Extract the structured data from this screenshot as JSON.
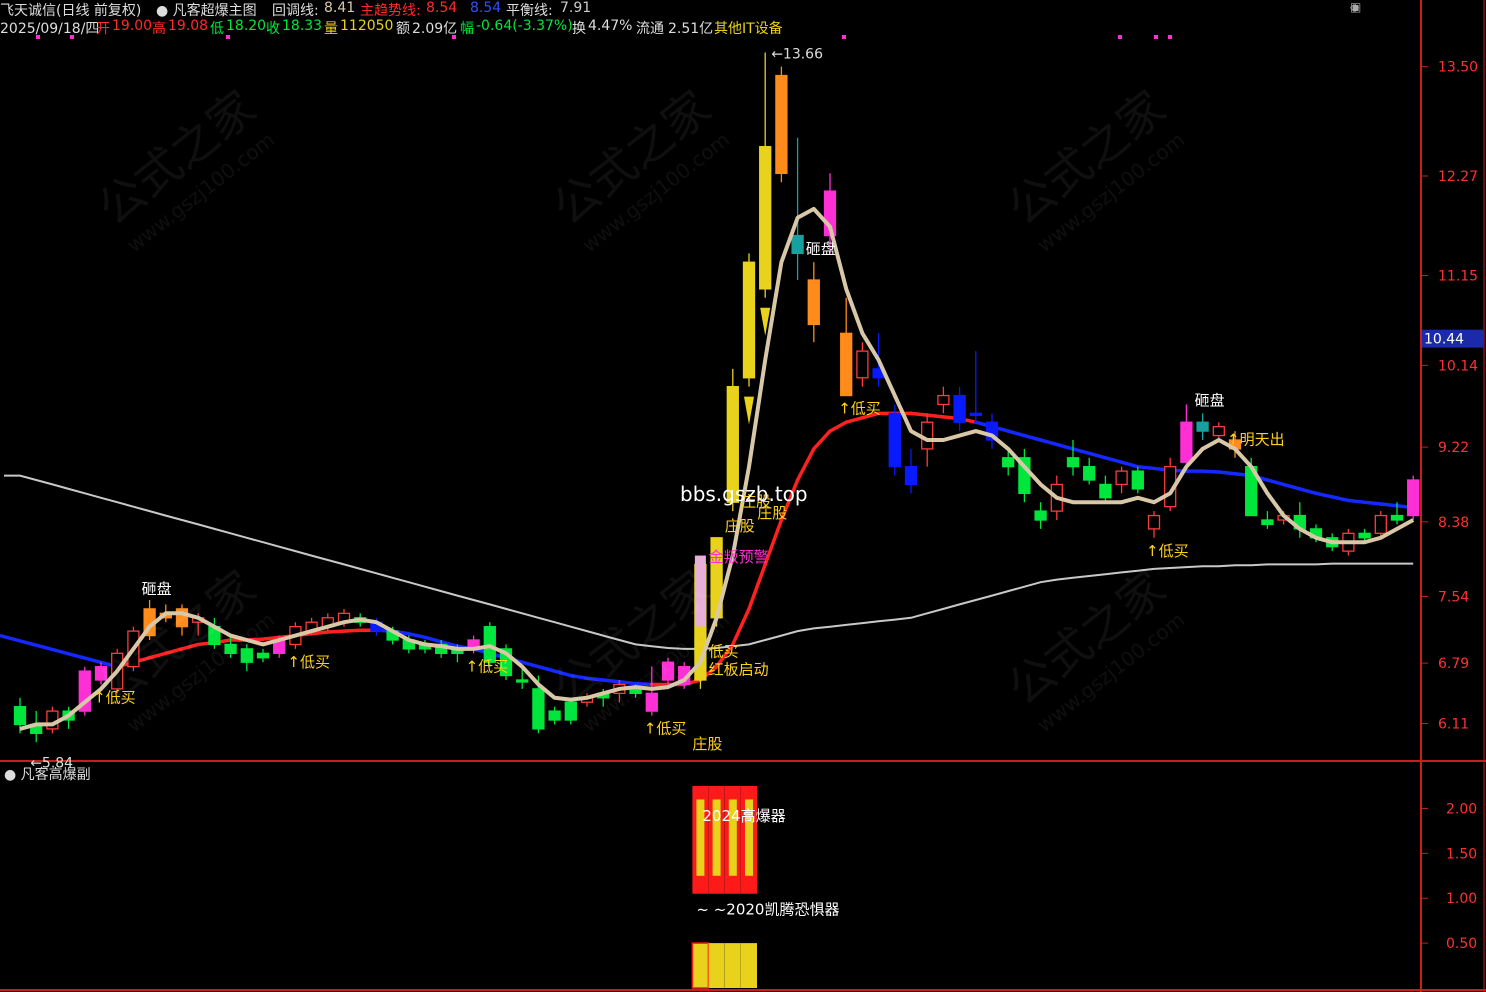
{
  "header": {
    "stock": "飞天诚信(日线 前复权)",
    "indicator": "凡客超爆主图",
    "callback_label": "回调线:",
    "callback_value": "8.41",
    "trend_label": "主趋势线:",
    "trend_value": "8.54",
    "trend_value2": "8.54",
    "balance_label": "平衡线:",
    "balance_value": "7.91",
    "date": "2025/09/18/四",
    "open_label": "开",
    "open": "19.00",
    "high_label": "高",
    "high": "19.08",
    "low_label": "低",
    "low": "18.20",
    "close_label": "收",
    "close": "18.33",
    "vol_label": "量",
    "vol": "112050",
    "amt_label": "额",
    "amt": "2.09亿",
    "chg_label": "幅",
    "chg": "-0.64(-3.37%)",
    "turn_label": "换",
    "turn": "4.47%",
    "float_label": "流通",
    "float": "2.51亿",
    "sector": "其他IT设备"
  },
  "colors": {
    "up": "#ff3b3b",
    "down": "#00e63d",
    "yellow": "#e8d21c",
    "orange": "#ff8c1a",
    "magenta": "#ff2fd6",
    "blue": "#0a1aff",
    "teal": "#18a0a0",
    "callback": "#d8c8a8",
    "trend_up": "#ff2020",
    "trend_down": "#1428ff",
    "balance": "#c8c8c8",
    "axis": "#c81e1e"
  },
  "subchart": {
    "title": "凡客高爆副",
    "label_top": "2024高爆器",
    "label_mid": "~ ~2020凯腾恐惧器"
  },
  "watermark": {
    "cn": "公式之家",
    "url": "www.gszj100.com",
    "site": "bbs.gszb.top"
  },
  "chart_data": {
    "type": "candlestick",
    "ylim": [
      5.7,
      13.8
    ],
    "yticks": [
      "13.50",
      "12.27",
      "11.15",
      "10.14",
      "9.22",
      "8.38",
      "7.54",
      "6.79",
      "6.11"
    ],
    "current_price_tag": "10.44",
    "max_label": "13.66",
    "min_label": "5.84",
    "sub_ylim": [
      0,
      2.25
    ],
    "sub_yticks": [
      "2.00",
      "1.50",
      "1.00",
      "0.50"
    ],
    "candles": [
      [
        6.3,
        6.4,
        6.0,
        6.1,
        "g"
      ],
      [
        6.1,
        6.25,
        5.9,
        6.0,
        "g"
      ],
      [
        6.05,
        6.3,
        6.0,
        6.25,
        "u"
      ],
      [
        6.25,
        6.3,
        6.05,
        6.15,
        "g"
      ],
      [
        6.25,
        6.75,
        6.2,
        6.7,
        "m"
      ],
      [
        6.6,
        6.8,
        6.55,
        6.75,
        "m"
      ],
      [
        6.5,
        6.95,
        6.45,
        6.9,
        "u"
      ],
      [
        6.75,
        7.2,
        6.7,
        7.15,
        "u"
      ],
      [
        7.1,
        7.5,
        7.05,
        7.4,
        "o"
      ],
      [
        7.3,
        7.45,
        7.25,
        7.35,
        "o"
      ],
      [
        7.4,
        7.45,
        7.1,
        7.2,
        "o"
      ],
      [
        7.25,
        7.35,
        7.1,
        7.3,
        "u"
      ],
      [
        7.2,
        7.3,
        6.95,
        7.0,
        "g"
      ],
      [
        7.0,
        7.1,
        6.85,
        6.9,
        "g"
      ],
      [
        6.8,
        7.0,
        6.7,
        6.95,
        "g"
      ],
      [
        6.85,
        6.95,
        6.8,
        6.9,
        "g"
      ],
      [
        6.9,
        7.1,
        6.85,
        7.05,
        "m"
      ],
      [
        7.0,
        7.25,
        6.95,
        7.2,
        "u"
      ],
      [
        7.15,
        7.3,
        7.1,
        7.25,
        "u"
      ],
      [
        7.2,
        7.35,
        7.15,
        7.3,
        "u"
      ],
      [
        7.25,
        7.4,
        7.2,
        7.35,
        "u"
      ],
      [
        7.3,
        7.35,
        7.2,
        7.25,
        "g"
      ],
      [
        7.25,
        7.3,
        7.1,
        7.15,
        "b"
      ],
      [
        7.15,
        7.2,
        7.0,
        7.05,
        "g"
      ],
      [
        7.05,
        7.1,
        6.9,
        6.95,
        "g"
      ],
      [
        6.95,
        7.05,
        6.9,
        7.0,
        "g"
      ],
      [
        7.0,
        7.05,
        6.85,
        6.9,
        "g"
      ],
      [
        6.9,
        7.0,
        6.8,
        6.95,
        "g"
      ],
      [
        6.95,
        7.1,
        6.9,
        7.05,
        "m"
      ],
      [
        6.8,
        7.25,
        6.75,
        7.2,
        "g"
      ],
      [
        6.95,
        7.0,
        6.6,
        6.65,
        "g"
      ],
      [
        6.6,
        6.75,
        6.5,
        6.6,
        "g"
      ],
      [
        6.5,
        6.65,
        6.0,
        6.05,
        "g"
      ],
      [
        6.15,
        6.3,
        6.1,
        6.25,
        "g"
      ],
      [
        6.15,
        6.4,
        6.1,
        6.35,
        "g"
      ],
      [
        6.35,
        6.45,
        6.3,
        6.4,
        "u"
      ],
      [
        6.4,
        6.5,
        6.3,
        6.45,
        "g"
      ],
      [
        6.45,
        6.6,
        6.35,
        6.55,
        "u"
      ],
      [
        6.5,
        6.55,
        6.4,
        6.45,
        "g"
      ],
      [
        6.45,
        6.75,
        6.2,
        6.25,
        "m"
      ],
      [
        6.6,
        6.85,
        6.55,
        6.8,
        "m"
      ],
      [
        6.55,
        6.8,
        6.5,
        6.75,
        "m"
      ],
      [
        6.6,
        7.9,
        6.5,
        7.9,
        "y"
      ],
      [
        7.3,
        8.2,
        7.2,
        8.2,
        "y"
      ],
      [
        8.6,
        10.1,
        8.5,
        9.9,
        "y"
      ],
      [
        10.0,
        11.4,
        9.9,
        11.3,
        "y"
      ],
      [
        11.0,
        13.66,
        10.9,
        12.6,
        "y"
      ],
      [
        12.3,
        13.5,
        12.2,
        13.4,
        "o"
      ],
      [
        11.4,
        12.7,
        11.1,
        11.6,
        "t"
      ],
      [
        10.6,
        11.3,
        10.4,
        11.1,
        "o"
      ],
      [
        12.1,
        12.3,
        11.4,
        11.6,
        "m"
      ],
      [
        10.5,
        10.9,
        9.8,
        9.8,
        "o"
      ],
      [
        10.0,
        10.4,
        9.9,
        10.3,
        "u"
      ],
      [
        10.1,
        10.5,
        9.9,
        10.0,
        "b"
      ],
      [
        9.6,
        9.7,
        8.9,
        9.0,
        "b"
      ],
      [
        9.0,
        9.2,
        8.7,
        8.8,
        "b"
      ],
      [
        9.5,
        9.6,
        9.0,
        9.2,
        "u"
      ],
      [
        9.7,
        9.9,
        9.6,
        9.8,
        "u"
      ],
      [
        9.8,
        9.9,
        9.4,
        9.5,
        "b"
      ],
      [
        9.6,
        10.3,
        9.5,
        9.6,
        "b"
      ],
      [
        9.5,
        9.6,
        9.2,
        9.3,
        "b"
      ],
      [
        9.1,
        9.2,
        8.9,
        9.0,
        "g"
      ],
      [
        9.1,
        9.2,
        8.6,
        8.7,
        "g"
      ],
      [
        8.5,
        8.6,
        8.3,
        8.4,
        "g"
      ],
      [
        8.5,
        8.9,
        8.4,
        8.8,
        "u"
      ],
      [
        9.1,
        9.3,
        8.9,
        9.0,
        "g"
      ],
      [
        9.0,
        9.1,
        8.8,
        8.85,
        "g"
      ],
      [
        8.8,
        8.9,
        8.6,
        8.65,
        "g"
      ],
      [
        8.8,
        9.0,
        8.7,
        8.95,
        "u"
      ],
      [
        8.95,
        9.0,
        8.7,
        8.75,
        "g"
      ],
      [
        8.3,
        8.5,
        8.2,
        8.45,
        "u"
      ],
      [
        8.55,
        9.1,
        8.5,
        9.0,
        "u"
      ],
      [
        9.5,
        9.7,
        9.0,
        9.05,
        "m"
      ],
      [
        9.4,
        9.6,
        9.3,
        9.5,
        "t"
      ],
      [
        9.45,
        9.5,
        9.3,
        9.35,
        "u"
      ],
      [
        9.3,
        9.4,
        9.1,
        9.2,
        "o"
      ],
      [
        9.0,
        9.1,
        8.5,
        8.45,
        "g"
      ],
      [
        8.4,
        8.5,
        8.3,
        8.35,
        "g"
      ],
      [
        8.4,
        8.5,
        8.35,
        8.45,
        "u"
      ],
      [
        8.45,
        8.6,
        8.2,
        8.3,
        "g"
      ],
      [
        8.3,
        8.35,
        8.15,
        8.2,
        "g"
      ],
      [
        8.2,
        8.25,
        8.05,
        8.1,
        "g"
      ],
      [
        8.05,
        8.3,
        8.0,
        8.25,
        "u"
      ],
      [
        8.25,
        8.3,
        8.15,
        8.2,
        "g"
      ],
      [
        8.25,
        8.5,
        8.2,
        8.45,
        "u"
      ],
      [
        8.45,
        8.6,
        8.35,
        8.4,
        "g"
      ],
      [
        8.45,
        8.9,
        8.4,
        8.85,
        "m"
      ]
    ],
    "callback_line": [
      6.05,
      6.1,
      6.1,
      6.2,
      6.35,
      6.5,
      6.7,
      6.95,
      7.2,
      7.35,
      7.35,
      7.3,
      7.2,
      7.1,
      7.05,
      7.0,
      7.05,
      7.1,
      7.15,
      7.2,
      7.25,
      7.28,
      7.25,
      7.15,
      7.05,
      7.0,
      6.98,
      6.95,
      6.95,
      6.98,
      6.9,
      6.75,
      6.55,
      6.4,
      6.38,
      6.4,
      6.45,
      6.5,
      6.52,
      6.5,
      6.52,
      6.6,
      6.8,
      7.3,
      8.0,
      9.0,
      10.2,
      11.3,
      11.8,
      11.9,
      11.7,
      11.0,
      10.5,
      10.2,
      9.8,
      9.4,
      9.3,
      9.3,
      9.35,
      9.4,
      9.35,
      9.2,
      9.0,
      8.8,
      8.65,
      8.6,
      8.6,
      8.6,
      8.6,
      8.65,
      8.6,
      8.7,
      9.0,
      9.2,
      9.3,
      9.2,
      9.0,
      8.7,
      8.45,
      8.3,
      8.2,
      8.15,
      8.15,
      8.15,
      8.2,
      8.3,
      8.4
    ],
    "trend_line": [
      null,
      null,
      null,
      null,
      null,
      null,
      6.75,
      6.8,
      6.85,
      6.9,
      6.95,
      7.0,
      7.02,
      7.05,
      7.05,
      7.06,
      7.08,
      7.1,
      7.12,
      7.14,
      7.15,
      7.16,
      7.16,
      7.15,
      7.12,
      7.08,
      7.03,
      6.98,
      6.95,
      6.9,
      6.85,
      6.8,
      6.75,
      6.7,
      6.65,
      6.62,
      6.6,
      6.58,
      6.56,
      6.55,
      6.55,
      6.55,
      6.6,
      6.75,
      7.0,
      7.4,
      7.9,
      8.4,
      8.85,
      9.2,
      9.4,
      9.5,
      9.55,
      9.6,
      9.6,
      9.6,
      9.58,
      9.56,
      9.54,
      9.5,
      9.45,
      9.4,
      9.35,
      9.3,
      9.25,
      9.2,
      9.15,
      9.1,
      9.05,
      9.0,
      8.98,
      8.96,
      8.95,
      8.95,
      8.94,
      8.92,
      8.9,
      8.85,
      8.8,
      8.75,
      8.7,
      8.66,
      8.62,
      8.6,
      8.58,
      8.56,
      8.54
    ],
    "trend_red_range": [
      6,
      59
    ],
    "balance_line": [
      8.9,
      8.85,
      8.8,
      8.75,
      8.7,
      8.65,
      8.6,
      8.55,
      8.5,
      8.45,
      8.4,
      8.35,
      8.3,
      8.25,
      8.2,
      8.15,
      8.1,
      8.05,
      8.0,
      7.95,
      7.9,
      7.85,
      7.8,
      7.75,
      7.7,
      7.65,
      7.6,
      7.55,
      7.5,
      7.45,
      7.4,
      7.35,
      7.3,
      7.25,
      7.2,
      7.15,
      7.1,
      7.05,
      7.0,
      6.98,
      6.96,
      6.95,
      6.95,
      6.96,
      6.98,
      7.0,
      7.05,
      7.1,
      7.15,
      7.18,
      7.2,
      7.22,
      7.24,
      7.26,
      7.28,
      7.3,
      7.35,
      7.4,
      7.45,
      7.5,
      7.55,
      7.6,
      7.65,
      7.7,
      7.73,
      7.75,
      7.77,
      7.79,
      7.81,
      7.83,
      7.85,
      7.86,
      7.87,
      7.88,
      7.88,
      7.89,
      7.89,
      7.9,
      7.9,
      7.9,
      7.9,
      7.91,
      7.91,
      7.91,
      7.91,
      7.91,
      7.91
    ],
    "signals": [
      {
        "i": 5,
        "text": "↑低买",
        "color": "#ffd21a",
        "side": "below"
      },
      {
        "i": 17,
        "text": "↑低买",
        "color": "#ffd21a",
        "side": "below"
      },
      {
        "i": 28,
        "text": "↑低买",
        "color": "#ffd21a",
        "side": "below"
      },
      {
        "i": 39,
        "text": "↑低买",
        "color": "#ffd21a",
        "side": "below"
      },
      {
        "i": 43,
        "text": "低买",
        "color": "#ffd21a",
        "side": "below",
        "dy": 30
      },
      {
        "i": 43,
        "text": "红板启动",
        "color": "#ffd21a",
        "side": "below",
        "dy": 48
      },
      {
        "i": 42,
        "text": "庄股",
        "color": "#ffd21a",
        "side": "below",
        "dy": 60
      },
      {
        "i": 44,
        "text": "庄股",
        "color": "#ffd21a",
        "side": "below",
        "dy": 20
      },
      {
        "i": 43,
        "text": "金叛预警",
        "color": "#ff2fd6",
        "side": "mid",
        "dy": -20
      },
      {
        "i": 45,
        "text": "庄股",
        "color": "#ffd21a",
        "side": "below",
        "dy": 120
      },
      {
        "i": 46,
        "text": "庄股",
        "color": "#ffd21a",
        "side": "below",
        "dy": 220
      },
      {
        "i": 51,
        "text": "↑低买",
        "color": "#ffd21a",
        "side": "below"
      },
      {
        "i": 70,
        "text": "↑低买",
        "color": "#ffd21a",
        "side": "below"
      },
      {
        "i": 75,
        "text": "↑明天出",
        "color": "#ffd21a",
        "side": "mid",
        "dy": 0
      },
      {
        "i": 8,
        "text": "砸盘",
        "color": "#ffffff",
        "side": "above"
      },
      {
        "i": 49,
        "text": "砸盘",
        "color": "#ffffff",
        "side": "above"
      },
      {
        "i": 73,
        "text": "砸盘",
        "color": "#ffffff",
        "side": "above"
      }
    ],
    "sub_bars": [
      {
        "i": 42,
        "top": 2.25,
        "bottom": 1.05
      },
      {
        "i": 43,
        "top": 2.25,
        "bottom": 1.05
      },
      {
        "i": 44,
        "top": 2.25,
        "bottom": 1.05
      },
      {
        "i": 45,
        "top": 2.25,
        "bottom": 1.05
      }
    ],
    "sub_low_bars": [
      42,
      43,
      44,
      45
    ]
  }
}
